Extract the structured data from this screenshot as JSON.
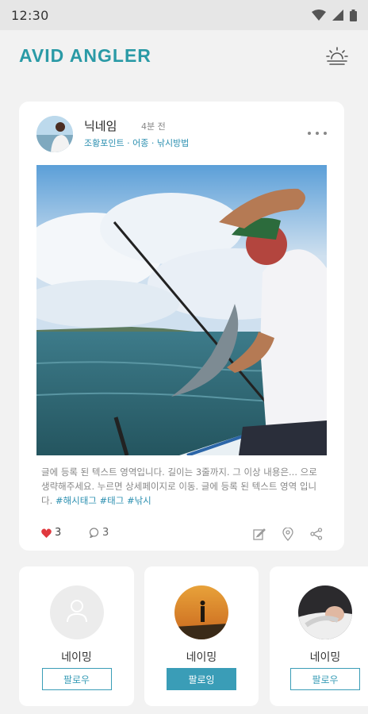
{
  "status_bar": {
    "time": "12:30"
  },
  "header": {
    "logo": "AVID ANGLER",
    "weather_icon": "sunrise-icon"
  },
  "post": {
    "author": "닉네임",
    "time_ago": "4분 전",
    "meta": "조황포인트 · 어종 · 낚시방법",
    "body": "글에 등록 된 텍스트 영역입니다. 길이는 3줄까지. 그 이상 내용은... 으로 생략해주세요. 누르면 상세페이지로 이동. 글에 등록 된 텍스트 영역 입니다.",
    "hashtags": "#해시태그 #태그 #낚시",
    "likes": "3",
    "comments": "3",
    "colors": {
      "accent": "#2a9aa6",
      "like": "#e0383e",
      "tag": "#2b8fb0"
    }
  },
  "recommended_users": [
    {
      "name": "네이밍",
      "button": "팔로우",
      "following": false
    },
    {
      "name": "네이밍",
      "button": "팔로잉",
      "following": true
    },
    {
      "name": "네이밍",
      "button": "팔로우",
      "following": false
    }
  ]
}
